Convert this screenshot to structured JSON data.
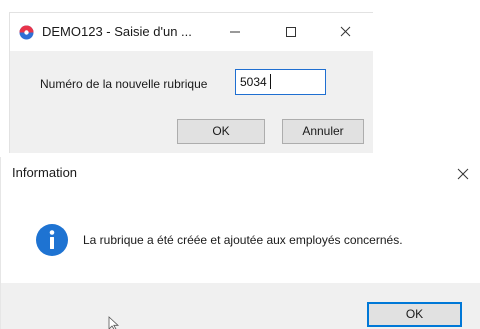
{
  "dialog_create": {
    "title": "DEMO123 - Saisie d'un ...",
    "field_label": "Numéro de la nouvelle rubrique",
    "field_value": "5034",
    "ok_label": "OK",
    "cancel_label": "Annuler"
  },
  "dialog_info": {
    "title": "Information",
    "message": "La rubrique a été créée et ajoutée aux employés concernés.",
    "ok_label": "OK"
  },
  "colors": {
    "focus_border": "#0078d7",
    "info_icon": "#1e73d2",
    "logo_top": "#e8344a",
    "logo_bottom": "#2f6fd6"
  }
}
